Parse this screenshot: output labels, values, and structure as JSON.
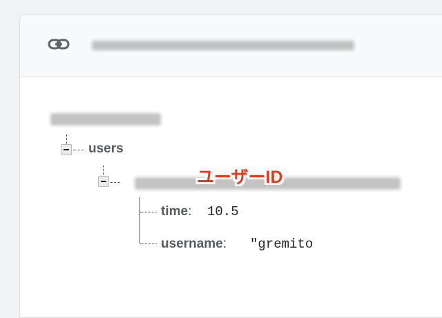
{
  "icons": {
    "link": "link-icon",
    "collapse": "collapse-toggle-icon"
  },
  "tree": {
    "users": {
      "label": "users"
    },
    "time": {
      "key": "time",
      "colon": ":",
      "value": "10.5"
    },
    "username": {
      "key": "username",
      "colon": ":",
      "value": "\"gremito"
    }
  },
  "annotation": {
    "text": "ユーザーID",
    "color": "#e8381c"
  },
  "colors": {
    "background": "#f1f3f4",
    "card": "#ffffff",
    "url_bar": "#f8f9fa",
    "label": "#555b61"
  }
}
